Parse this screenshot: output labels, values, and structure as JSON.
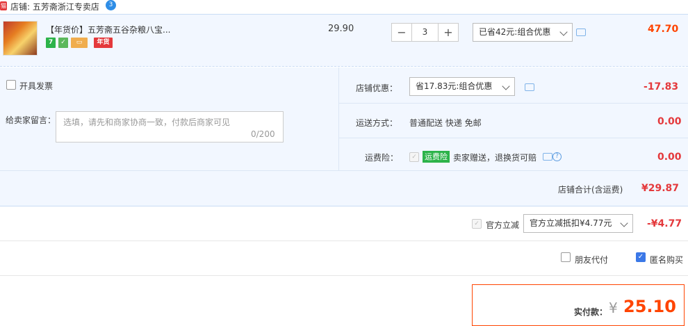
{
  "shop": {
    "icon_text": "猫",
    "name": "店铺: 五芳斋浙江专卖店",
    "badge": "3"
  },
  "item": {
    "title": "【年货价】五芳斋五谷杂粮八宝...",
    "tags": [
      "7",
      "",
      "",
      "年货"
    ],
    "unit_price": "29.90",
    "quantity": "3",
    "minus": "−",
    "plus": "+",
    "promo": "已省42元:组合优惠",
    "total": "47.70"
  },
  "invoice": {
    "label": "开具发票"
  },
  "message": {
    "label": "给卖家留言：",
    "placeholder": "选填，请先和商家协商一致，付款后商家可见",
    "counter": "0/200"
  },
  "shop_discount": {
    "label": "店铺优惠：",
    "value": "省17.83元:组合优惠",
    "amount": "-17.83"
  },
  "shipping": {
    "label": "运送方式：",
    "value": "普通配送 快递 免邮",
    "amount": "0.00"
  },
  "insurance": {
    "label": "运费险：",
    "badge": "运费险",
    "text": "卖家赠送，退换货可赔",
    "amount": "0.00"
  },
  "subtotal": {
    "label": "店铺合计(含运费)",
    "amount": "¥29.87"
  },
  "official": {
    "label": "官方立减",
    "value": "官方立减抵扣¥4.77元",
    "amount": "-¥4.77"
  },
  "friend_pay": {
    "label": "朋友代付"
  },
  "anonymous": {
    "label": "匿名购买"
  },
  "payment": {
    "label": "实付款：",
    "currency": "¥",
    "amount": "25.10"
  }
}
